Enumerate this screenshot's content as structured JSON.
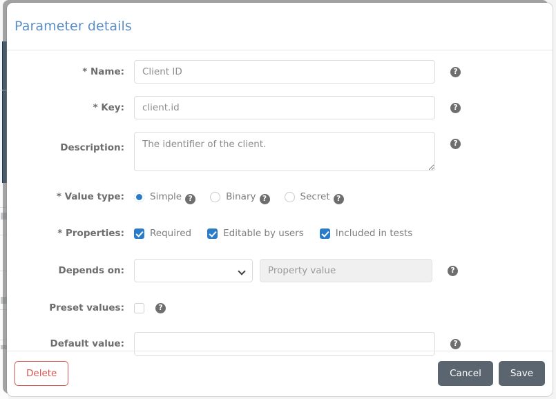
{
  "dialog": {
    "title": "Parameter details"
  },
  "form": {
    "name": {
      "label": "* Name:",
      "value": "Client ID",
      "help_icon": "help-icon"
    },
    "key": {
      "label": "* Key:",
      "value": "client.id",
      "help_icon": "help-icon"
    },
    "description": {
      "label": "Description:",
      "value": "The identifier of the client.",
      "help_icon": "help-icon"
    },
    "value_type": {
      "label": "* Value type:",
      "selected": "Simple",
      "options": [
        {
          "label": "Simple",
          "checked": true
        },
        {
          "label": "Binary",
          "checked": false
        },
        {
          "label": "Secret",
          "checked": false
        }
      ]
    },
    "properties": {
      "label": "* Properties:",
      "options": [
        {
          "label": "Required",
          "checked": true
        },
        {
          "label": "Editable by users",
          "checked": true
        },
        {
          "label": "Included in tests",
          "checked": true
        }
      ]
    },
    "depends_on": {
      "label": "Depends on:",
      "select_value": "",
      "property_value_placeholder": "Property value",
      "help_icon": "help-icon",
      "chevron_icon": "chevron-down-icon"
    },
    "preset_values": {
      "label": "Preset values:",
      "checked": false,
      "help_icon": "help-icon"
    },
    "default_value": {
      "label": "Default value:",
      "value": "",
      "help_icon": "help-icon"
    }
  },
  "footer": {
    "delete_label": "Delete",
    "cancel_label": "Cancel",
    "save_label": "Save"
  },
  "icons": {
    "help": "?"
  },
  "colors": {
    "title_blue": "#5b8ec4",
    "accent_blue": "#2a7bc8",
    "danger_red": "#d9534f",
    "button_gray": "#5a6570",
    "label_gray": "#6d6d6d"
  }
}
